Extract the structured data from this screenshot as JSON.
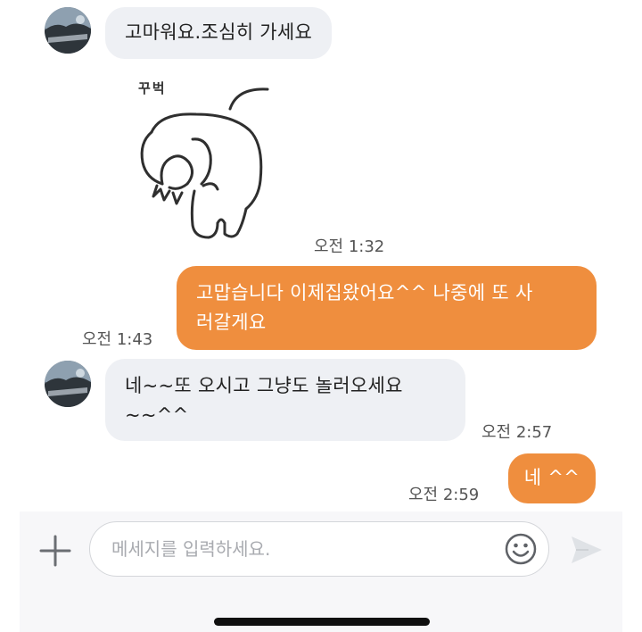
{
  "chat": {
    "messages": [
      {
        "sender": "other",
        "text": "고마워요.조심히 가세요"
      },
      {
        "sender": "other",
        "sticker_text": "꾸벅",
        "sticker_icon": "bowing-creature-sticker",
        "time": "오전 1:32"
      },
      {
        "sender": "me",
        "line1": "고맙습니다 이제집왔어요^^ 나중에 또 사",
        "line2": "러갈게요",
        "time": "오전 1:43"
      },
      {
        "sender": "other",
        "line1": "네~~또 오시고 그냥도 놀러오세요",
        "line2": "~~^^",
        "time": "오전 2:57"
      },
      {
        "sender": "me",
        "text": "네 ^^",
        "time": "오전 2:59"
      }
    ]
  },
  "composer": {
    "placeholder": "메세지를 입력하세요.",
    "add_icon": "plus-icon",
    "emoji_icon": "smiley-icon",
    "send_icon": "send-arrow-icon"
  },
  "colors": {
    "outgoing_bubble": "#ef8e3e",
    "incoming_bubble": "#eef0f4",
    "background": "#ffffff"
  }
}
